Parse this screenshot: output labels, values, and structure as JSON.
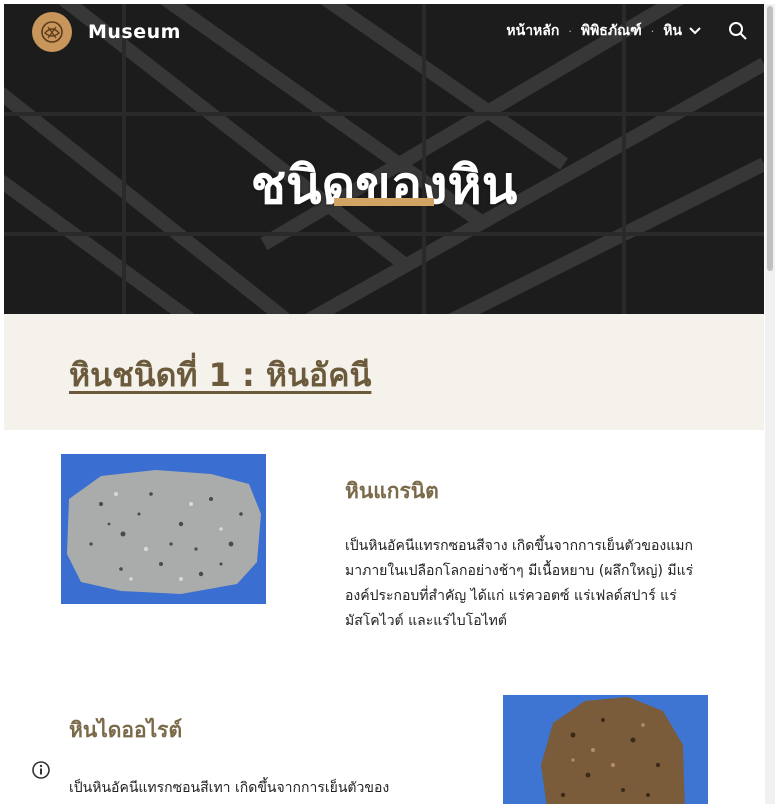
{
  "site": {
    "name": "Museum"
  },
  "nav": {
    "items": [
      {
        "label": "หน้าหลัก"
      },
      {
        "label": "พิพิธภัณฑ์"
      },
      {
        "label": "หิน"
      }
    ]
  },
  "hero": {
    "title": "ชนิดของหิน"
  },
  "section": {
    "heading": "หินชนิดที่ 1 : หินอัคนี"
  },
  "rocks": [
    {
      "name": "หินแกรนิต",
      "description": "เป็นหินอัคนีแทรกซอนสีจาง เกิดขึ้นจากการเย็นตัวของแมกมาภายในเปลือกโลกอย่างช้าๆ มีเนื้อหยาบ (ผลึกใหญ่) มีแร่องค์ประกอบที่สำคัญ ได้แก่ แร่ควอตซ์ แร่เฟลด์สปาร์ แร่มัสโคไวต์ และแร่ไบโอไทต์"
    },
    {
      "name": "หินไดออไรต์",
      "description": "เป็นหินอัคนีแทรกซอนสีเทา เกิดขึ้นจากการเย็นตัวของ"
    }
  ],
  "colors": {
    "accent": "#d1a464",
    "heading": "#7b6a4a",
    "band": "#f5f2eb",
    "photo_backdrop": "#3b6fcf"
  },
  "icons": {
    "logo": "museum-logo-icon",
    "dropdown": "chevron-down-icon",
    "search": "search-icon",
    "info": "info-icon"
  }
}
